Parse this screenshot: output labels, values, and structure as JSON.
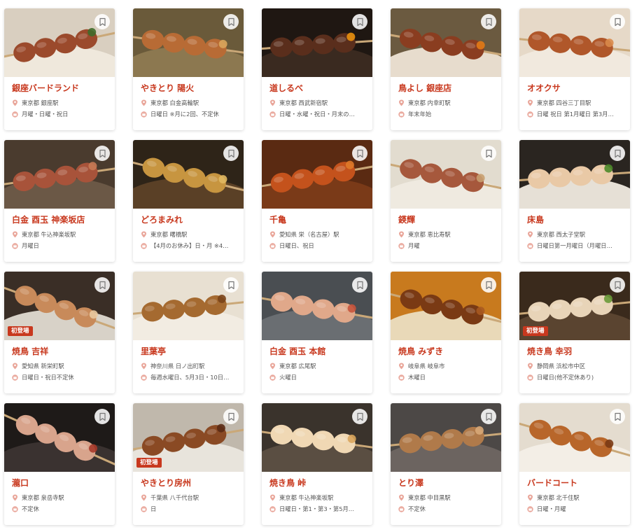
{
  "colors": {
    "accent": "#c8381e",
    "badge": "#c8381e",
    "meta_icon": "#e9a69a"
  },
  "icons": {
    "bookmark": "bookmark-icon",
    "location": "location-pin-icon",
    "holiday": "closed-day-icon"
  },
  "restaurants": [
    {
      "name": "銀座バードランド",
      "location": "東京都 銀座駅",
      "holiday": "月曜・日曜・祝日",
      "badge": "",
      "photo": {
        "bg": "#d9cfc0",
        "plate": "#efe8dc",
        "meat": "#9b4a2c",
        "accent": "#3f6b2a"
      }
    },
    {
      "name": "やきとり 陽火",
      "location": "東京都 白金高輪駅",
      "holiday": "日曜日 ※月に2回、不定休",
      "badge": "",
      "photo": {
        "bg": "#6a5a3a",
        "plate": "#8c7850",
        "meat": "#b86b35",
        "accent": "#d9a55c"
      }
    },
    {
      "name": "道しるべ",
      "location": "東京都 西武新宿駅",
      "holiday": "日曜・水曜・祝日・月末の…",
      "badge": "",
      "photo": {
        "bg": "#1f1712",
        "plate": "#3a2a20",
        "meat": "#5a2e1c",
        "accent": "#e8900e"
      }
    },
    {
      "name": "鳥よし 銀座店",
      "location": "東京都 内幸町駅",
      "holiday": "年末年始",
      "badge": "",
      "photo": {
        "bg": "#6b5a40",
        "plate": "#e7dccd",
        "meat": "#8a3d20",
        "accent": "#e27a16"
      }
    },
    {
      "name": "オオクサ",
      "location": "東京都 四谷三丁目駅",
      "holiday": "日曜 祝日 第1月曜日 第3月…",
      "badge": "",
      "photo": {
        "bg": "#e6d9c8",
        "plate": "#f1e9de",
        "meat": "#b0572a",
        "accent": "#d98a4a"
      }
    },
    {
      "name": "白金 酉玉 神楽坂店",
      "location": "東京都 牛込神楽坂駅",
      "holiday": "月曜日",
      "badge": "",
      "photo": {
        "bg": "#4a3b2e",
        "plate": "#6b5846",
        "meat": "#a8533a",
        "accent": "#c77a55"
      }
    },
    {
      "name": "どろまみれ",
      "location": "東京都 曙橋駅",
      "holiday": "【4月のお休み】日・月 ※4…",
      "badge": "",
      "photo": {
        "bg": "#2e2418",
        "plate": "#5a4026",
        "meat": "#c79540",
        "accent": "#e0b862"
      }
    },
    {
      "name": "千亀",
      "location": "愛知県 栄（名古屋）駅",
      "holiday": "日曜日、祝日",
      "badge": "",
      "photo": {
        "bg": "#5a2a12",
        "plate": "#7a3a18",
        "meat": "#c4521c",
        "accent": "#e07a2a"
      }
    },
    {
      "name": "鍈輝",
      "location": "東京都 恵比寿駅",
      "holiday": "月曜",
      "badge": "",
      "photo": {
        "bg": "#e2dccf",
        "plate": "#efeae0",
        "meat": "#a6583c",
        "accent": "#c9a070"
      }
    },
    {
      "name": "床島",
      "location": "東京都 西太子堂駅",
      "holiday": "日曜日第一月曜日（月曜日…",
      "badge": "",
      "photo": {
        "bg": "#2a2520",
        "plate": "#e6e0d6",
        "meat": "#e9c9a6",
        "accent": "#4c8a2a"
      }
    },
    {
      "name": "焼鳥 吉祥",
      "location": "愛知県 新栄町駅",
      "holiday": "日曜日・祝日不定休",
      "badge": "初登場",
      "photo": {
        "bg": "#3a2e26",
        "plate": "#d8d2c8",
        "meat": "#c88a5a",
        "accent": "#e8c8a0"
      }
    },
    {
      "name": "里葉亭",
      "location": "神奈川県 日ノ出町駅",
      "holiday": "毎週水曜日、5月3日・10日…",
      "badge": "",
      "photo": {
        "bg": "#e8e0d2",
        "plate": "#f2ece2",
        "meat": "#a56a30",
        "accent": "#7a4418"
      }
    },
    {
      "name": "白金 酉玉 本館",
      "location": "東京都 広尾駅",
      "holiday": "火曜日",
      "badge": "",
      "photo": {
        "bg": "#4a4e52",
        "plate": "#6a6e72",
        "meat": "#e0a88a",
        "accent": "#c8543c"
      }
    },
    {
      "name": "焼鳥 みずき",
      "location": "岐阜県 岐阜市",
      "holiday": "木曜日",
      "badge": "",
      "photo": {
        "bg": "#c87a1e",
        "plate": "#e9d9b8",
        "meat": "#7a3a14",
        "accent": "#a85a20"
      }
    },
    {
      "name": "焼き鳥 幸羽",
      "location": "静岡県 浜松市中区",
      "holiday": "日曜日(他不定休あり)",
      "badge": "初登場",
      "photo": {
        "bg": "#3a2a1c",
        "plate": "#5a4430",
        "meat": "#e8d4b8",
        "accent": "#6a9a3a"
      }
    },
    {
      "name": "瀧口",
      "location": "東京都 泉岳寺駅",
      "holiday": "不定休",
      "badge": "",
      "photo": {
        "bg": "#1e1a18",
        "plate": "#3a3230",
        "meat": "#d8a48c",
        "accent": "#a83a2a"
      }
    },
    {
      "name": "やきとり房州",
      "location": "千葉県 八千代台駅",
      "holiday": "日",
      "badge": "初登場",
      "photo": {
        "bg": "#c0b8ac",
        "plate": "#e8e4dc",
        "meat": "#8a4a24",
        "accent": "#5a2a14"
      }
    },
    {
      "name": "焼き鳥 峠",
      "location": "東京都 牛込神楽坂駅",
      "holiday": "日曜日・第1・第3・第5月…",
      "badge": "",
      "photo": {
        "bg": "#3a332c",
        "plate": "#5a4e42",
        "meat": "#f0d8b4",
        "accent": "#d9a55c"
      }
    },
    {
      "name": "とり澤",
      "location": "東京都 中目黒駅",
      "holiday": "不定休",
      "badge": "",
      "photo": {
        "bg": "#4c4846",
        "plate": "#6c6460",
        "meat": "#b07a4a",
        "accent": "#d8a878"
      }
    },
    {
      "name": "バードコート",
      "location": "東京都 北千住駅",
      "holiday": "日曜・月曜",
      "badge": "",
      "photo": {
        "bg": "#e4dccf",
        "plate": "#f3eee6",
        "meat": "#b8662a",
        "accent": "#7a3a14"
      }
    }
  ]
}
